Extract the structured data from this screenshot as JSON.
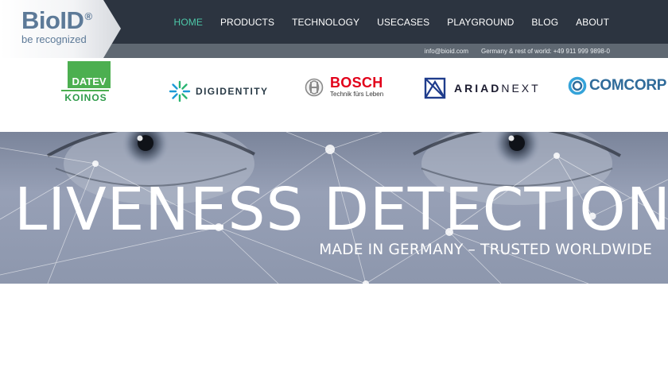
{
  "brand": {
    "name": "BioID",
    "registered": "®",
    "tagline": "be recognized"
  },
  "nav": {
    "items": [
      {
        "label": "HOME",
        "active": true
      },
      {
        "label": "PRODUCTS",
        "active": false
      },
      {
        "label": "TECHNOLOGY",
        "active": false
      },
      {
        "label": "USECASES",
        "active": false
      },
      {
        "label": "PLAYGROUND",
        "active": false
      },
      {
        "label": "BLOG",
        "active": false
      },
      {
        "label": "ABOUT",
        "active": false
      }
    ]
  },
  "contact": {
    "email": "info@bioid.com",
    "phone": "Germany & rest of world: +49 911 999 9898-0"
  },
  "partners": {
    "datev": {
      "top": "DATEV",
      "bottom": "KOINOS"
    },
    "digidentity": {
      "name": "DIGIDENTITY",
      "icon": "digidentity-starburst-icon"
    },
    "bosch": {
      "name": "BOSCH",
      "slogan": "Technik fürs Leben",
      "icon": "bosch-armature-icon"
    },
    "ariadnext": {
      "name_bold": "ARIAD",
      "name_light": "NEXT",
      "icon": "ariadnext-box-icon"
    },
    "comcorp": {
      "name": "COMCORP",
      "icon": "comcorp-ring-icon"
    }
  },
  "hero": {
    "title": "LIVENESS DETECTION",
    "subtitle": "MADE IN GERMANY – TRUSTED WORLDWIDE"
  },
  "colors": {
    "header_bg": "#2c3440",
    "subbar_bg": "#5f6872",
    "nav_active": "#4dc8a8",
    "brand_blue": "#5d7a98",
    "bosch_red": "#e2001a",
    "datev_green": "#4caf50",
    "comcorp_blue": "#2f6b9a"
  }
}
